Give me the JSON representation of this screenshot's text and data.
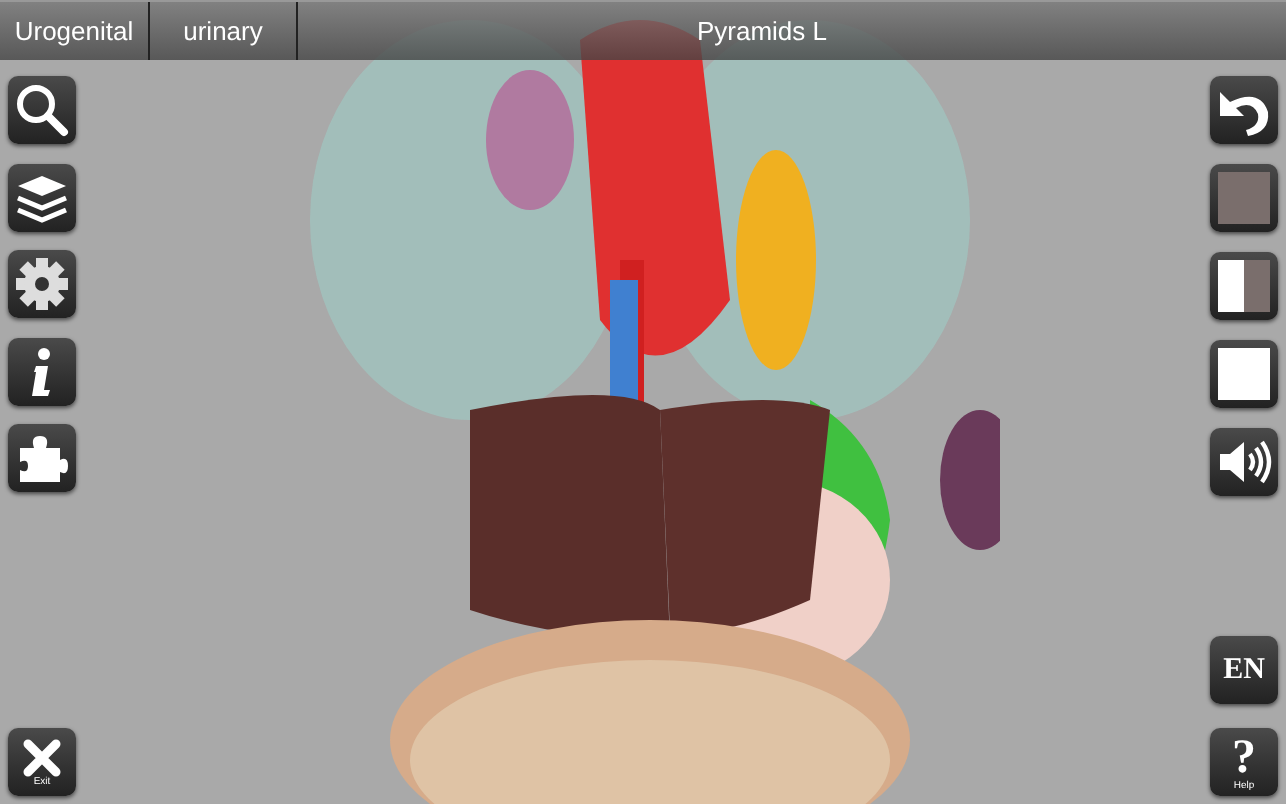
{
  "top_bar": {
    "tabs": [
      {
        "label": "Urogenital"
      },
      {
        "label": "urinary"
      }
    ],
    "title": "Pyramids L"
  },
  "left_toolbar": {
    "exit": {
      "label": "Exit"
    }
  },
  "right_toolbar": {
    "language": {
      "label": "EN"
    },
    "help": {
      "symbol": "?",
      "label": "Help"
    }
  }
}
